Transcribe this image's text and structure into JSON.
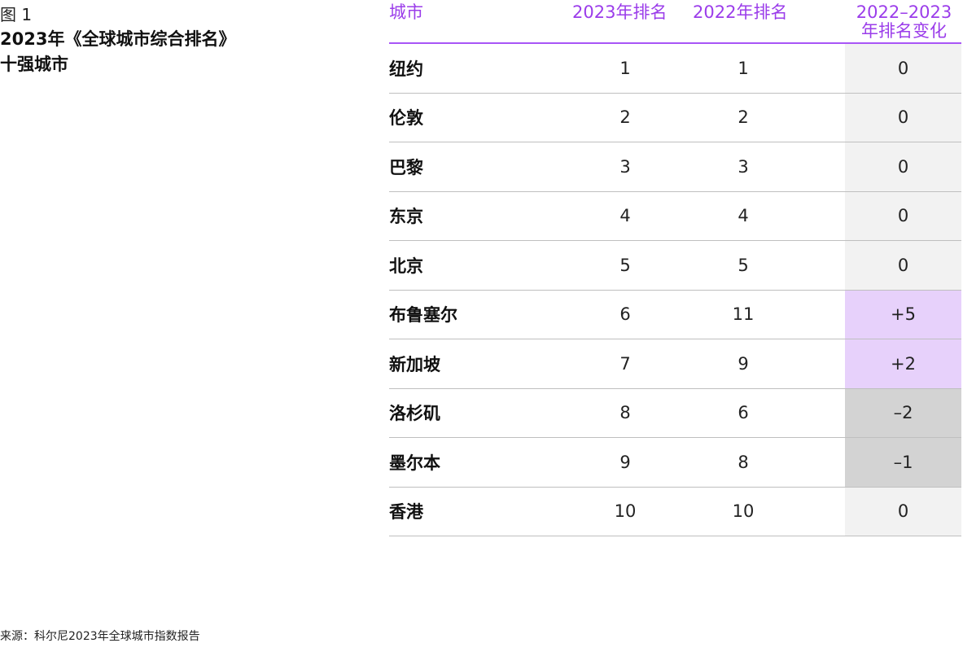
{
  "figure": {
    "label": "图 1",
    "title_line1": "2023年《全球城市综合排名》",
    "title_line2": "十强城市"
  },
  "table": {
    "headers": {
      "city": "城市",
      "rank2023": "2023年排名",
      "rank2022": "2022年排名",
      "change_line1": "2022–2023",
      "change_line2": "年排名变化"
    },
    "rows": [
      {
        "city": "纽约",
        "rank2023": "1",
        "rank2022": "1",
        "change": "0",
        "trend": "same"
      },
      {
        "city": "伦敦",
        "rank2023": "2",
        "rank2022": "2",
        "change": "0",
        "trend": "same"
      },
      {
        "city": "巴黎",
        "rank2023": "3",
        "rank2022": "3",
        "change": "0",
        "trend": "same"
      },
      {
        "city": "东京",
        "rank2023": "4",
        "rank2022": "4",
        "change": "0",
        "trend": "same"
      },
      {
        "city": "北京",
        "rank2023": "5",
        "rank2022": "5",
        "change": "0",
        "trend": "same"
      },
      {
        "city": "布鲁塞尔",
        "rank2023": "6",
        "rank2022": "11",
        "change": "+5",
        "trend": "up"
      },
      {
        "city": "新加坡",
        "rank2023": "7",
        "rank2022": "9",
        "change": "+2",
        "trend": "up"
      },
      {
        "city": "洛杉矶",
        "rank2023": "8",
        "rank2022": "6",
        "change": "–2",
        "trend": "down"
      },
      {
        "city": "墨尔本",
        "rank2023": "9",
        "rank2022": "8",
        "change": "–1",
        "trend": "down"
      },
      {
        "city": "香港",
        "rank2023": "10",
        "rank2022": "10",
        "change": "0",
        "trend": "same"
      }
    ]
  },
  "source": "来源：科尔尼2023年全球城市指数报告",
  "colors": {
    "accent": "#9b3dea",
    "header_rule": "#a855f7",
    "up_fill": "#e7d1fb",
    "down_fill": "#d3d3d3",
    "same_fill": "#f2f2f2"
  }
}
